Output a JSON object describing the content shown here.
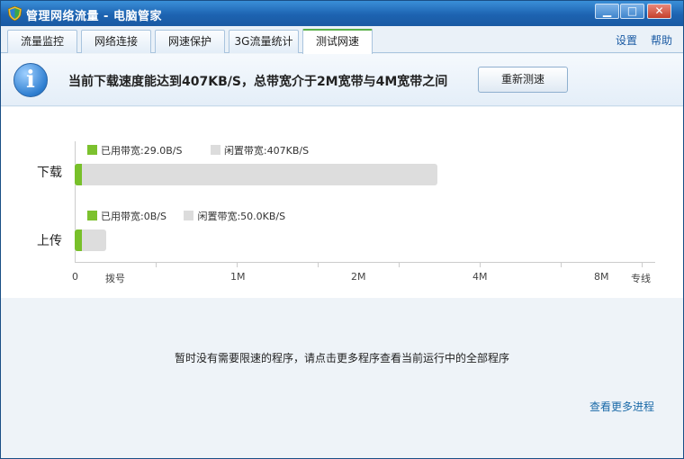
{
  "window": {
    "title": "管理网络流量 - 电脑管家",
    "controls": {
      "minimize": "▁",
      "maximize": "□",
      "close": "✕"
    }
  },
  "tabs": [
    {
      "label": "流量监控"
    },
    {
      "label": "网络连接"
    },
    {
      "label": "网速保护"
    },
    {
      "label": "3G流量统计"
    },
    {
      "label": "测试网速",
      "active": true
    }
  ],
  "toplinks": {
    "settings": "设置",
    "help": "帮助"
  },
  "banner": {
    "icon": "i",
    "message": "当前下载速度能达到407KB/S，总带宽介于2M宽带与4M宽带之间",
    "retest_button": "重新测速"
  },
  "download": {
    "label": "下载",
    "used_label": "已用带宽:29.0B/S",
    "idle_label": "闲置带宽:407KB/S",
    "total_fraction": 0.625
  },
  "upload": {
    "label": "上传",
    "used_label": "已用带宽:0B/S",
    "idle_label": "闲置带宽:50.0KB/S",
    "total_fraction": 0.055
  },
  "axis": {
    "ticks": [
      "0",
      "拨号",
      "1M",
      "2M",
      "4M",
      "8M",
      "专线"
    ]
  },
  "colors": {
    "used": "#78c02a",
    "idle": "#dddddd",
    "accent": "#1a5aa3"
  },
  "bottom": {
    "empty_message": "暂时没有需要限速的程序，请点击更多程序查看当前运行中的全部程序",
    "more_link": "查看更多进程"
  }
}
